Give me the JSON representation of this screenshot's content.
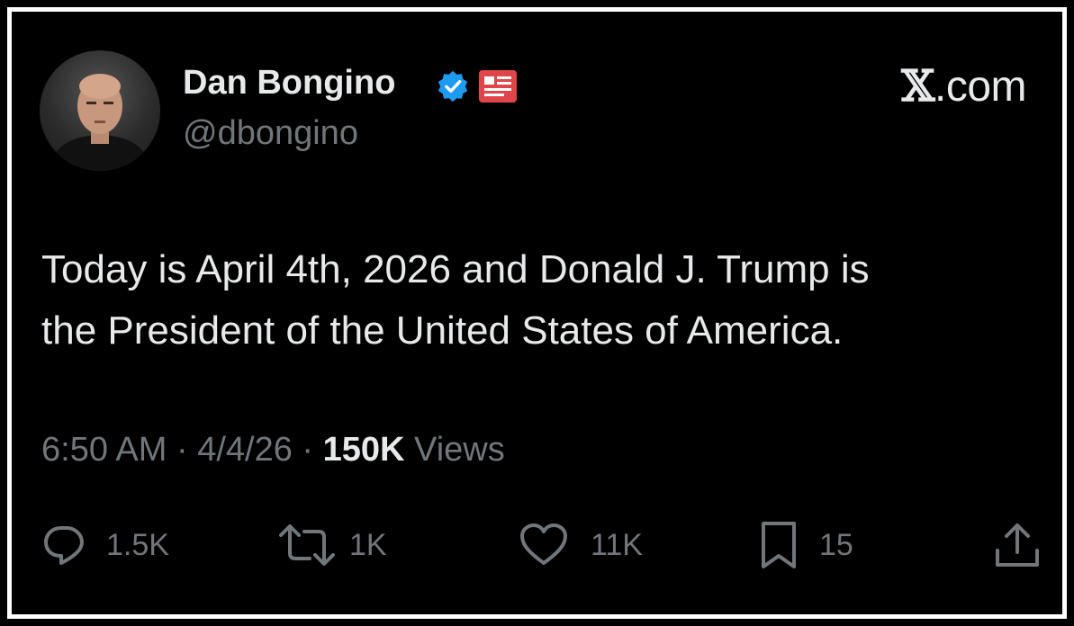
{
  "author": {
    "name": "Dan Bongino",
    "handle": "@dbongino"
  },
  "site": {
    "prefix": "𝕏",
    "suffix": ".com"
  },
  "tweet": {
    "line1": "Today is April 4th, 2026 and Donald J. Trump is",
    "line2": "the President of the United States of America."
  },
  "meta": {
    "time": "6:50 AM",
    "sep1": " · ",
    "date": "4/4/26",
    "sep2": " · ",
    "views_count": "150K",
    "views_label": " Views"
  },
  "actions": {
    "replies": "1.5K",
    "reposts": "1K",
    "likes": "11K",
    "bookmarks": "15"
  },
  "colors": {
    "background": "#000000",
    "border": "#ffffff",
    "text_primary": "#e7e9ea",
    "text_secondary": "#71767b",
    "verified_blue": "#1d9bf0",
    "news_badge_red": "#e0454a"
  },
  "icons": {
    "verified": "verified-badge-icon",
    "news": "news-badge-icon",
    "reply": "reply-icon",
    "repost": "repost-icon",
    "like": "heart-icon",
    "bookmark": "bookmark-icon",
    "share": "share-icon"
  }
}
